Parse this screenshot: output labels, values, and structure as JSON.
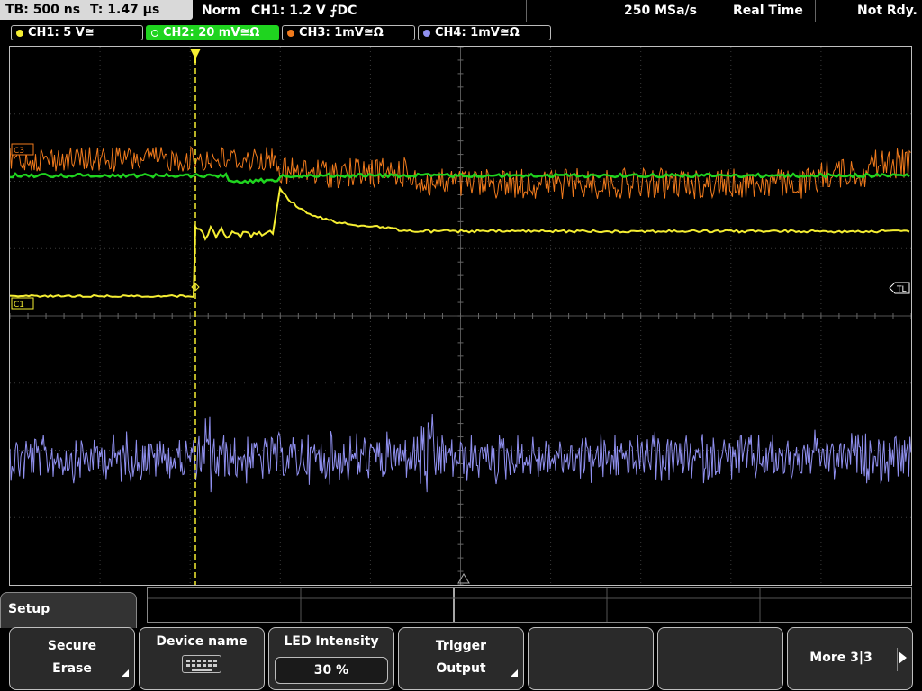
{
  "statusbar": {
    "timebase": "TB: 500 ns",
    "trigger_time": "T: 1.47 µs",
    "mode": "Norm",
    "trigger_info": "CH1: 1.2 V ⨍DC",
    "sample_rate": "250 MSa/s",
    "acq_mode": "Real Time",
    "status": "Not Rdy."
  },
  "channels": [
    {
      "label": "CH1: 5 V≅",
      "color": "#f5ee32"
    },
    {
      "label": "CH2: 20 mV≅Ω",
      "color": "#1fd41f",
      "active": true
    },
    {
      "label": "CH3: 1mV≅Ω",
      "color": "#f07a1c"
    },
    {
      "label": "CH4: 1mV≅Ω",
      "color": "#9090f0"
    }
  ],
  "markers": {
    "c3": "C3",
    "c1": "C1",
    "tl": "TL"
  },
  "menu": {
    "title": "Setup",
    "softkeys": [
      {
        "line1": "Secure",
        "line2": "Erase"
      },
      {
        "line1": "Device name",
        "icon": "keyboard-icon"
      },
      {
        "line1": "LED Intensity",
        "value": "30 %"
      },
      {
        "line1": "Trigger",
        "line2": "Output"
      },
      {
        "line1": ""
      },
      {
        "line1": ""
      },
      {
        "line1": "More 3|3"
      }
    ]
  }
}
